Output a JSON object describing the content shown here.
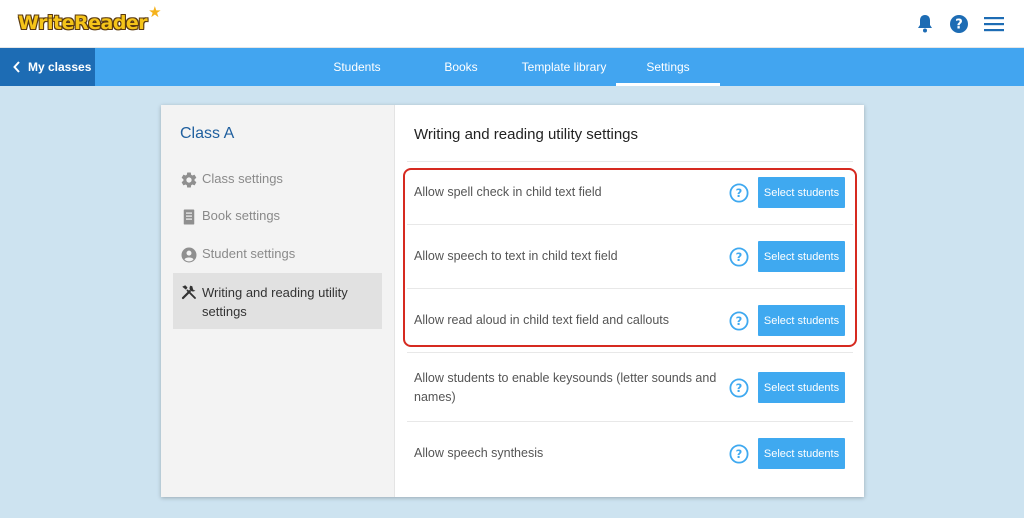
{
  "header": {
    "logo_text": "WriteReader",
    "icons": [
      "bell-icon",
      "help-icon",
      "menu-icon"
    ]
  },
  "nav": {
    "back_label": "My classes",
    "tabs": [
      {
        "label": "Students",
        "active": false
      },
      {
        "label": "Books",
        "active": false
      },
      {
        "label": "Template library",
        "active": false
      },
      {
        "label": "Settings",
        "active": true
      }
    ]
  },
  "sidebar": {
    "class_name": "Class A",
    "items": [
      {
        "label": "Class settings",
        "icon": "gear-icon"
      },
      {
        "label": "Book settings",
        "icon": "book-icon"
      },
      {
        "label": "Student settings",
        "icon": "user-icon"
      },
      {
        "label": "Writing and reading utility settings",
        "icon": "tools-icon",
        "active": true
      }
    ]
  },
  "main": {
    "title": "Writing and reading utility settings",
    "button_label": "Select students",
    "settings": [
      {
        "label": "Allow spell check in child text field"
      },
      {
        "label": "Allow speech to text in child text field"
      },
      {
        "label": "Allow read aloud in child text field and callouts"
      },
      {
        "label": "Allow students to enable keysounds (letter sounds and names)"
      },
      {
        "label": "Allow speech synthesis"
      }
    ]
  },
  "colors": {
    "nav_blue": "#42a5f0",
    "back_blue": "#1d6cb4",
    "button_blue": "#3fa9f0",
    "highlight_red": "#d62a20",
    "page_bg": "#cde3f0"
  }
}
